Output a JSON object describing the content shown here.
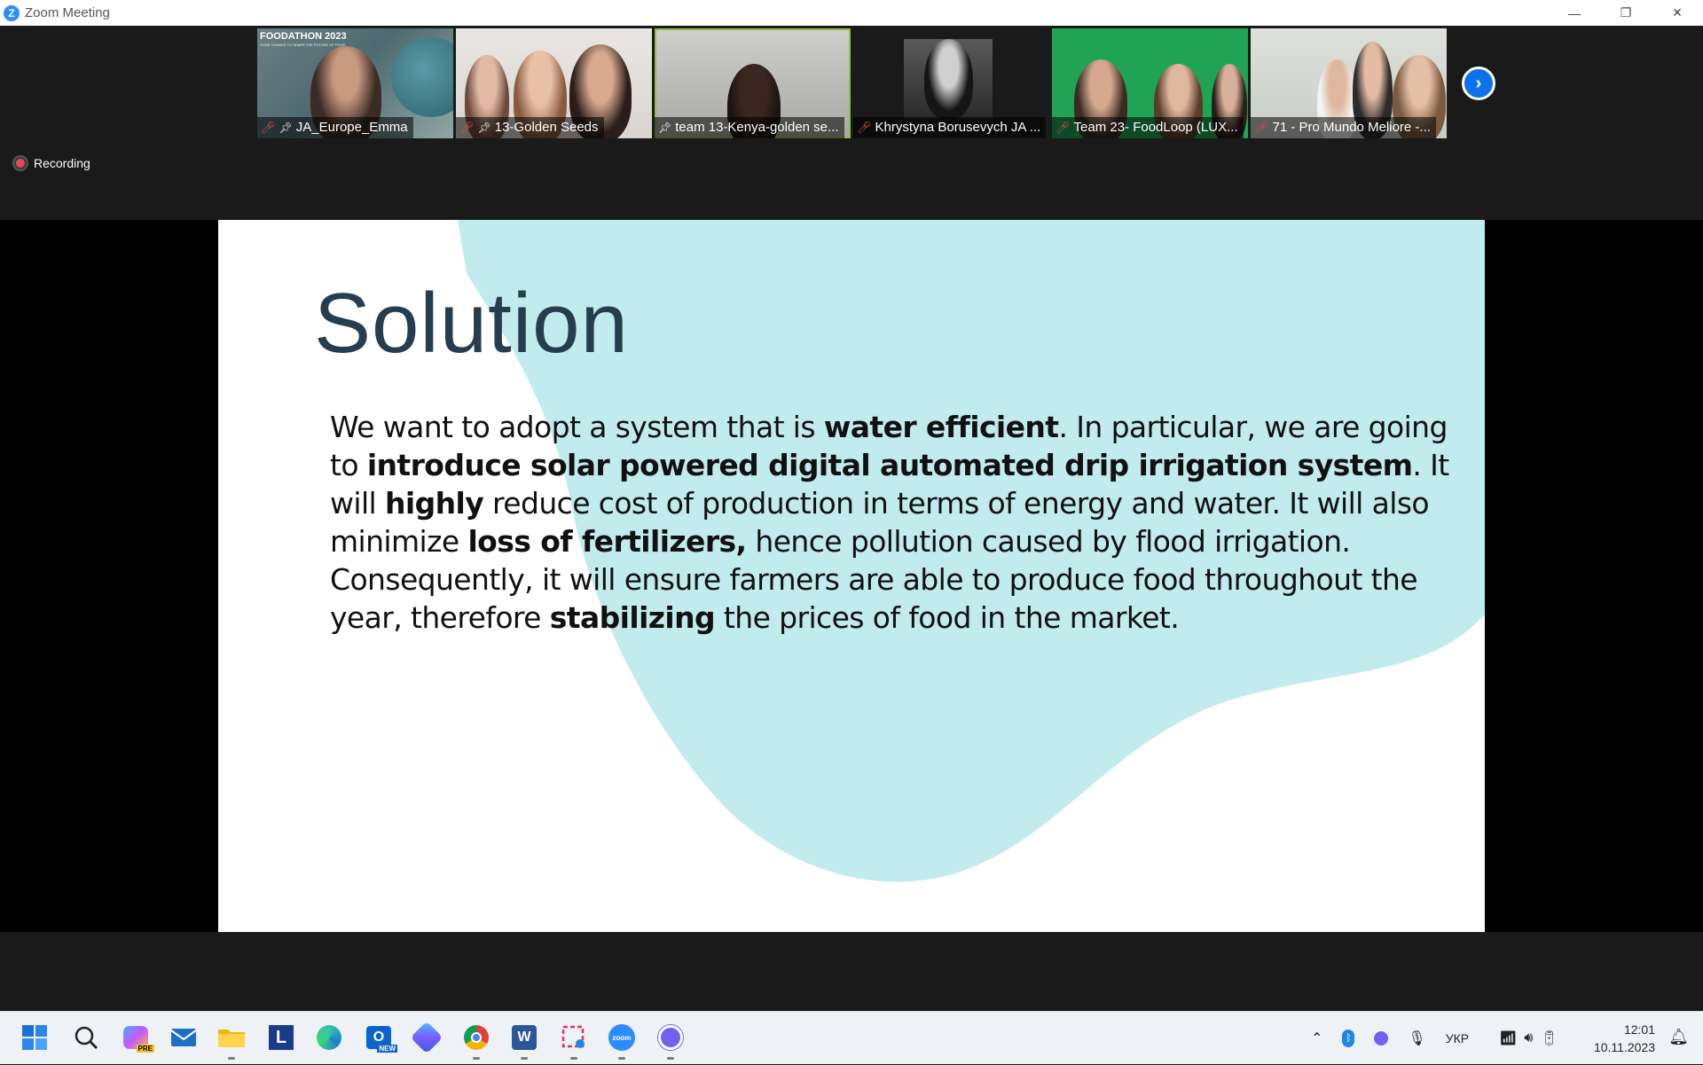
{
  "window": {
    "title": "Zoom Meeting",
    "minimize": "—",
    "restore": "❐",
    "close": "✕"
  },
  "participants": [
    {
      "name": "JA_Europe_Emma",
      "mic_muted": true,
      "pinned": true,
      "banner": "FOODATHON 2023",
      "banner_sub": "YOUR CHANCE TO SHAPE THE FUTURE OF FOOD"
    },
    {
      "name": "13-Golden Seeds",
      "mic_muted": true,
      "pinned": true
    },
    {
      "name": "team 13-Kenya-golden se...",
      "mic_muted": false,
      "pinned": true,
      "active": true
    },
    {
      "name": "Khrystyna Borusevych JA ...",
      "mic_muted": true,
      "pinned": false
    },
    {
      "name": "Team 23- FoodLoop (LUX...",
      "mic_muted": true,
      "pinned": false
    },
    {
      "name": "71 - Pro Mundo Meliore -...",
      "mic_muted": true,
      "pinned": false
    }
  ],
  "recording": {
    "label": "Recording"
  },
  "slide": {
    "title": "Solution",
    "body": [
      {
        "t": "We want to adopt a system that is ",
        "b": false
      },
      {
        "t": "water efficient",
        "b": true
      },
      {
        "t": ". In particular, we are going to ",
        "b": false
      },
      {
        "t": "introduce solar powered digital automated drip irrigation system",
        "b": true
      },
      {
        "t": ". It will ",
        "b": false
      },
      {
        "t": "highly",
        "b": true
      },
      {
        "t": " reduce cost of production in terms of energy and water. It will also minimize ",
        "b": false
      },
      {
        "t": "loss of fertilizers,",
        "b": true
      },
      {
        "t": " hence pollution caused by flood irrigation. Consequently, it will ensure farmers are able to produce food throughout the year, therefore ",
        "b": false
      },
      {
        "t": "stabilizing",
        "b": true
      },
      {
        "t": " the prices of food in the market.",
        "b": false
      }
    ]
  },
  "taskbar": {
    "apps": [
      "start-icon",
      "search-icon",
      "copilot-icon",
      "mail-icon",
      "file-explorer-icon",
      "lingvo-icon",
      "edge-icon",
      "outlook-icon",
      "copilot-app-icon",
      "chrome-icon",
      "word-icon",
      "snipping-tool-icon",
      "zoom-icon",
      "viber-icon"
    ],
    "l_label": "L",
    "w_label": "W",
    "zoom_label": "zoom",
    "pre_label": "PRE",
    "new_label": "NEW",
    "language": "УКР",
    "time": "12:01",
    "date": "10.11.2023"
  },
  "colors": {
    "zoom_blue": "#0e72ed",
    "slide_title": "#263d4f",
    "slide_blob": "#c2ebee",
    "mute_red": "#e5484d",
    "active_outline": "#8fc04a"
  }
}
